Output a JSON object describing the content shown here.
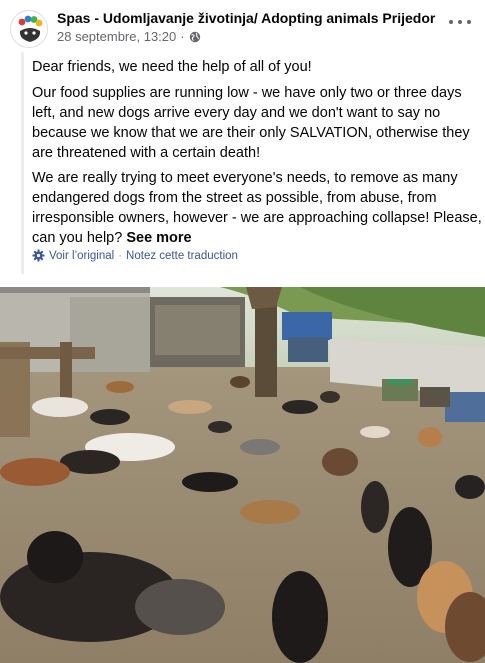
{
  "post": {
    "page_name": "Spas - Udomljavanje životinja/ Adopting animals Prijedor",
    "timestamp": "28 septembre, 13:20",
    "separator": "·",
    "privacy_icon": "globe-icon",
    "paragraphs": [
      "Dear friends, we need the help of all of you!",
      "Our food supplies are running low - we have only two or three days left, and new dogs arrive every day and we don't want to say no because we know that we are their only SALVATION, otherwise they are threatened with a certain death!",
      "We are really trying to meet everyone's needs, to remove as many endangered dogs from the street as possible, from abuse, from irresponsible owners, however - we are approaching collapse! Please, can you help?"
    ],
    "see_more_label": "See more",
    "see_original_label": "Voir l’original",
    "translate_sep": "·",
    "rate_translation_label": "Notez cette traduction",
    "translation_icon": "gear-icon",
    "more_icon": "more-dots-icon",
    "accent_color": "#385898"
  }
}
